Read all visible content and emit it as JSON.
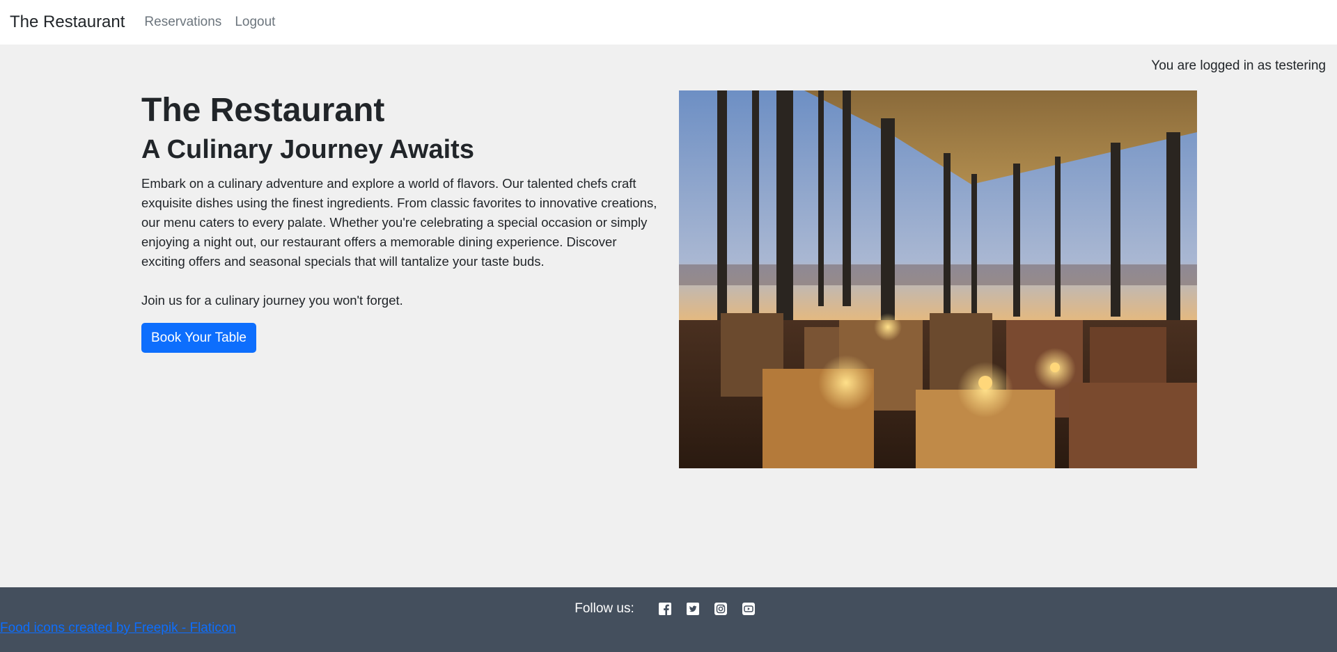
{
  "navbar": {
    "brand": "The Restaurant",
    "links": [
      "Reservations",
      "Logout"
    ]
  },
  "login_status": "You are logged in as testering",
  "hero": {
    "title": "The Restaurant",
    "subtitle": "A Culinary Journey Awaits",
    "description": "Embark on a culinary adventure and explore a world of flavors. Our talented chefs craft exquisite dishes using the finest ingredients. From classic favorites to innovative creations, our menu caters to every palate. Whether you're celebrating a special occasion or simply enjoying a night out, our restaurant offers a memorable dining experience. Discover exciting offers and seasonal specials that will tantalize your taste buds.",
    "join_text": "Join us for a culinary journey you won't forget.",
    "button_label": "Book Your Table",
    "image_subject": "restaurant-dining-room-photo"
  },
  "footer": {
    "follow_label": "Follow us:",
    "social_icons": [
      "facebook-icon",
      "twitter-icon",
      "instagram-icon",
      "youtube-icon"
    ],
    "credit_link": "Food icons created by Freepik - Flaticon"
  },
  "colors": {
    "primary": "#0d6efd",
    "footer_bg": "#444f5d",
    "page_bg": "#f0f0f0",
    "nav_bg": "#ffffff"
  }
}
